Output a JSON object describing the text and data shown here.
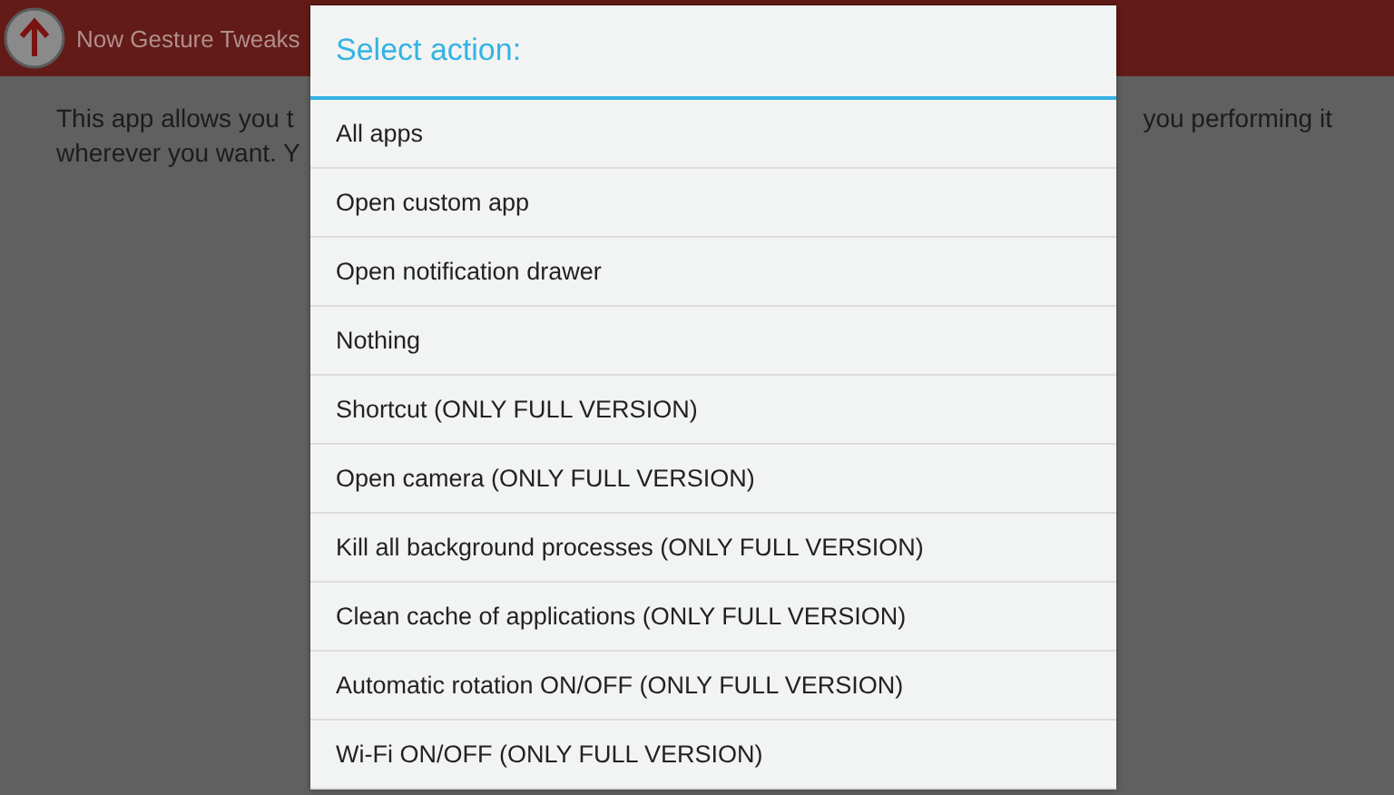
{
  "action_bar": {
    "title": "Now Gesture Tweaks"
  },
  "background_text": {
    "left_lines": [
      "This app allows you t",
      "wherever you want. Y"
    ],
    "right_lines": [
      "you performing it"
    ]
  },
  "dialog": {
    "title": "Select action:",
    "items": [
      {
        "label": "All apps"
      },
      {
        "label": "Open custom app"
      },
      {
        "label": "Open notification drawer"
      },
      {
        "label": "Nothing"
      },
      {
        "label": "Shortcut (ONLY FULL VERSION)"
      },
      {
        "label": "Open camera (ONLY FULL VERSION)"
      },
      {
        "label": "Kill all background processes (ONLY FULL VERSION)"
      },
      {
        "label": "Clean cache of applications (ONLY FULL VERSION)"
      },
      {
        "label": "Automatic rotation ON/OFF (ONLY FULL VERSION)"
      },
      {
        "label": "Wi-Fi ON/OFF (ONLY FULL VERSION)"
      }
    ]
  }
}
